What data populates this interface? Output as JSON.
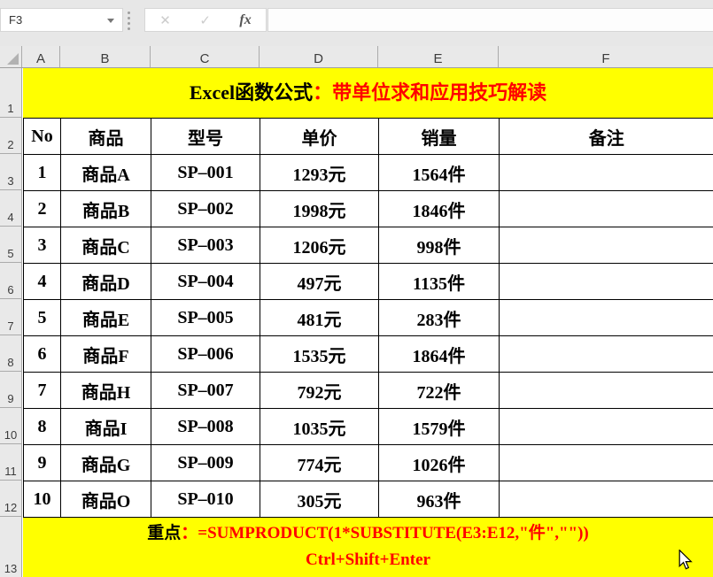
{
  "chrome": {
    "name_box_value": "F3",
    "formula_bar_value": "",
    "cancel_label": "✕",
    "enter_label": "✓",
    "fx_label": "fx"
  },
  "sheet": {
    "column_headers": [
      "A",
      "B",
      "C",
      "D",
      "E",
      "F"
    ],
    "row_headers": [
      "1",
      "2",
      "3",
      "4",
      "5",
      "6",
      "7",
      "8",
      "9",
      "10",
      "11",
      "12",
      "13"
    ],
    "title": {
      "black_part": "Excel函数公式",
      "red_part": "：带单位求和应用技巧解读"
    },
    "table": {
      "headers": [
        "No",
        "商品",
        "型号",
        "单价",
        "销量",
        "备注"
      ],
      "rows": [
        [
          "1",
          "商品A",
          "SP–001",
          "1293元",
          "1564件",
          ""
        ],
        [
          "2",
          "商品B",
          "SP–002",
          "1998元",
          "1846件",
          ""
        ],
        [
          "3",
          "商品C",
          "SP–003",
          "1206元",
          "998件",
          ""
        ],
        [
          "4",
          "商品D",
          "SP–004",
          "497元",
          "1135件",
          ""
        ],
        [
          "5",
          "商品E",
          "SP–005",
          "481元",
          "283件",
          ""
        ],
        [
          "6",
          "商品F",
          "SP–006",
          "1535元",
          "1864件",
          ""
        ],
        [
          "7",
          "商品H",
          "SP–007",
          "792元",
          "722件",
          ""
        ],
        [
          "8",
          "商品I",
          "SP–008",
          "1035元",
          "1579件",
          ""
        ],
        [
          "9",
          "商品G",
          "SP–009",
          "774元",
          "1026件",
          ""
        ],
        [
          "10",
          "商品O",
          "SP–010",
          "305元",
          "963件",
          ""
        ]
      ]
    },
    "footer": {
      "black_part": "重点",
      "red_line1": "：=SUMPRODUCT(1*SUBSTITUTE(E3:E12,\"件\",\"\"))",
      "red_line2": "Ctrl+Shift+Enter"
    }
  },
  "colors": {
    "banner_background": "#ffff00",
    "accent_red": "#ff0000",
    "grid_border": "#000000",
    "chrome_background": "#e7e7e7"
  }
}
